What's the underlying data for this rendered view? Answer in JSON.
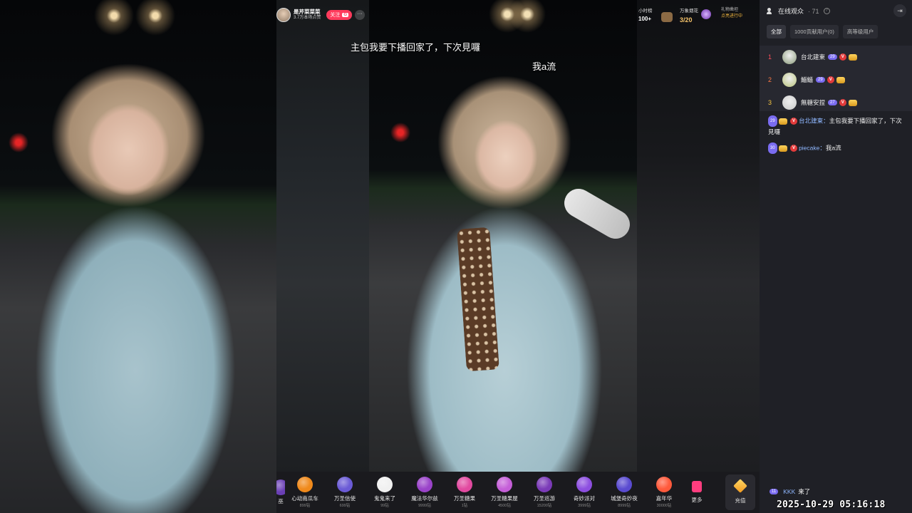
{
  "anchor": {
    "name": "是芹菜菜菜",
    "likes": "3.7万本场点赞",
    "follow_label": "关注",
    "follow_badge": "G",
    "more": "···"
  },
  "top_right": {
    "rank_label": "小时榜",
    "rank_value": "100+",
    "progress_label": "万象烟花",
    "progress_value": "3/20",
    "event_label": "礼物凿坦",
    "event_status": "点亮进行中"
  },
  "danmaku": [
    "主包我要下播回家了，下次見囉",
    "我a流"
  ],
  "gifts": [
    {
      "name": "巫",
      "price": "",
      "color": "#6a3fb5"
    },
    {
      "name": "心动南瓜车",
      "price": "899钻",
      "color": "#f08a1c"
    },
    {
      "name": "万圣信使",
      "price": "699钻",
      "color": "#6b5bd6"
    },
    {
      "name": "鬼鬼来了",
      "price": "99钻",
      "color": "#f0f0f0"
    },
    {
      "name": "魔法华尔兹",
      "price": "9999钻",
      "color": "#9a43c9"
    },
    {
      "name": "万圣糖果",
      "price": "1钻",
      "color": "#e24aa0"
    },
    {
      "name": "万圣糖果屋",
      "price": "4500钻",
      "color": "#c55fd8"
    },
    {
      "name": "万圣巡游",
      "price": "15200钻",
      "color": "#7b3bb8"
    },
    {
      "name": "奇妙派对",
      "price": "3999钻",
      "color": "#8d4fe0"
    },
    {
      "name": "城堡奇妙夜",
      "price": "8999钻",
      "color": "#5a4bd0"
    },
    {
      "name": "嘉年华",
      "price": "30000钻",
      "color": "#ff5a3c"
    }
  ],
  "gift_more": "更多",
  "recharge": "充值",
  "panel": {
    "title": "在线观众",
    "count": "· 71",
    "filters": [
      "全部",
      "1000贡献用户(0)",
      "高等级用户"
    ],
    "ranking": [
      {
        "rank": "1",
        "name": "台北建東",
        "level": "29",
        "rank_color": "#ff4d5a",
        "avatar": "#8a9a7a"
      },
      {
        "rank": "2",
        "name": "鯔鯔",
        "level": "29",
        "rank_color": "#ff7a45",
        "avatar": "#b8c27a"
      },
      {
        "rank": "3",
        "name": "無糖安捏",
        "level": "27",
        "rank_color": "#f5c542",
        "avatar": "#c9c9c9"
      }
    ],
    "chat": [
      {
        "level": "29",
        "user": "台北建東：",
        "text": "主包我要下播回家了，下次見囉"
      },
      {
        "level": "30",
        "user": "piecake：",
        "text": "我a流"
      }
    ],
    "enter": {
      "level": "11",
      "user": "KKK",
      "text": "来了"
    }
  },
  "timestamp": "2025-10-29 05:16:18"
}
